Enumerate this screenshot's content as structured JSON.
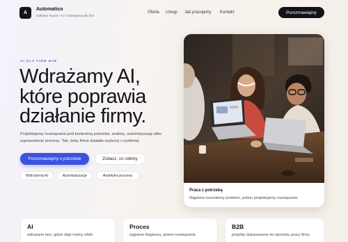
{
  "header": {
    "logo_letter": "A",
    "brand_name": "Automatico",
    "brand_tagline": "software house / AI / rozwiązania dla firm",
    "menu": [
      "Oferta",
      "Usługi",
      "Jak pracujemy",
      "Kontakt"
    ],
    "cta_label": "Porozmawiajmy"
  },
  "hero": {
    "eyebrow": "AI DLA FIRM B2B",
    "headline": "Wdrażamy AI, które poprawia działanie firmy.",
    "description": "Projektujemy rozwiązania pod konkretną potrzebę: analizę, automatyzację albo usprawnienie procesu. Tak, żeby firma działała szybciej i czytelniej.",
    "primary_button": "Porozmawiajmy o potrzebie",
    "secondary_button": "Zobacz, co robimy",
    "tags": [
      "Wdrożenia AI",
      "Automatyzacje",
      "Analityka procesu"
    ]
  },
  "photo_card": {
    "title": "Praca z potrzebą",
    "text": "Najpierw rozumiemy problem, potem projektujemy rozwiązanie."
  },
  "cards": [
    {
      "title": "AI",
      "text": "wdrażane tam, gdzie daje realny efekt"
    },
    {
      "title": "Proces",
      "text": "najpierw diagnoza, potem rozwiązanie"
    },
    {
      "title": "B2B",
      "text": "projekty dopasowane do sposobu pracy firmy"
    }
  ],
  "colors": {
    "accent": "#3b51e0",
    "dark": "#121217",
    "eyebrow": "#5867d8"
  }
}
